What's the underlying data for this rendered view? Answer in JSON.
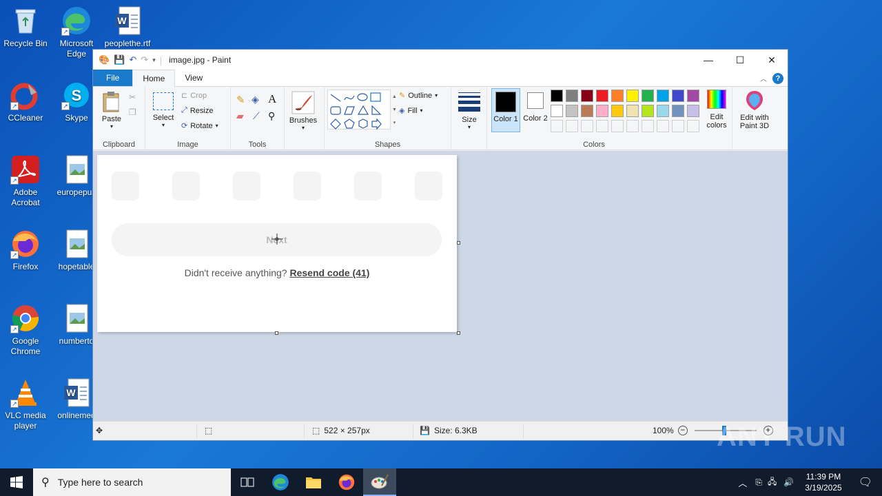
{
  "desktop": {
    "icons": [
      {
        "label": "Recycle Bin"
      },
      {
        "label": "Microsoft Edge"
      },
      {
        "label": "peoplethe.rtf"
      },
      {
        "label": "CCleaner"
      },
      {
        "label": "Skype"
      },
      {
        "label": "Adobe Acrobat"
      },
      {
        "label": "europepus"
      },
      {
        "label": "Firefox"
      },
      {
        "label": "hopetable"
      },
      {
        "label": "Google Chrome"
      },
      {
        "label": "numberto"
      },
      {
        "label": "VLC media player"
      },
      {
        "label": "onlinemed"
      }
    ]
  },
  "window": {
    "title": "image.jpg - Paint",
    "tabs": {
      "file": "File",
      "home": "Home",
      "view": "View"
    },
    "ribbon": {
      "clipboard": {
        "label": "Clipboard",
        "paste": "Paste"
      },
      "image": {
        "label": "Image",
        "select": "Select",
        "crop": "Crop",
        "resize": "Resize",
        "rotate": "Rotate"
      },
      "tools": {
        "label": "Tools"
      },
      "brushes": {
        "label": "Brushes"
      },
      "shapes": {
        "label": "Shapes",
        "outline": "Outline",
        "fill": "Fill"
      },
      "size": {
        "label": "Size"
      },
      "colors": {
        "label": "Colors",
        "color1": "Color 1",
        "color2": "Color 2",
        "edit_colors": "Edit colors",
        "edit_3d": "Edit with Paint 3D",
        "palette_row1": [
          "#000000",
          "#7f7f7f",
          "#880015",
          "#ed1c24",
          "#ff7f27",
          "#fff200",
          "#22b14c",
          "#00a2e8",
          "#3f48cc",
          "#a349a4"
        ],
        "palette_row2": [
          "#ffffff",
          "#c3c3c3",
          "#b97a57",
          "#ffaec9",
          "#ffc90e",
          "#efe4b0",
          "#b5e61d",
          "#99d9ea",
          "#7092be",
          "#c8bfe7"
        ]
      }
    },
    "canvas": {
      "next_button": "Next",
      "resend_prefix": "Didn't receive anything?",
      "resend_link": "Resend code (41)"
    },
    "status": {
      "dimensions": "522 × 257px",
      "size": "Size: 6.3KB",
      "zoom": "100%"
    }
  },
  "taskbar": {
    "search_placeholder": "Type here to search",
    "time": "11:39 PM",
    "date": "3/19/2025"
  },
  "watermark": "ANY RUN"
}
